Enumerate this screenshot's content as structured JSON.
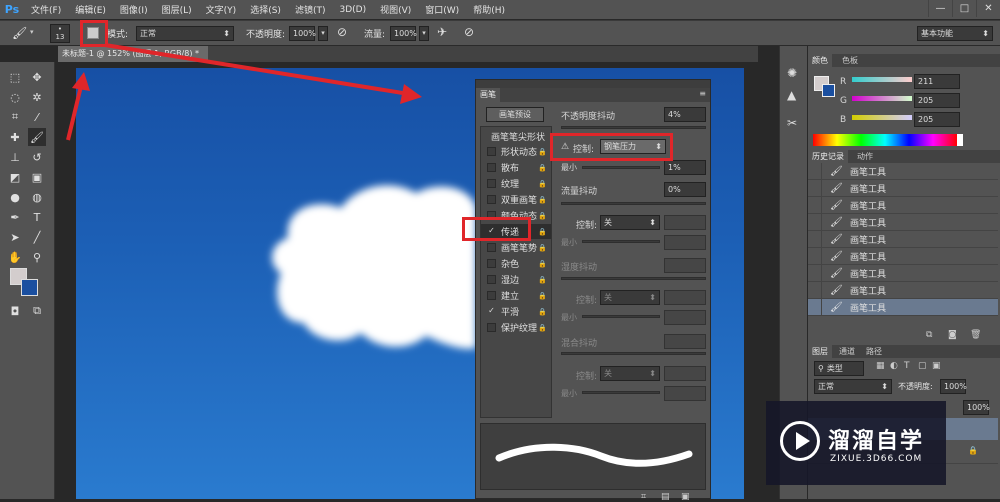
{
  "app": {
    "logo": "Ps"
  },
  "menu": [
    "文件(F)",
    "编辑(E)",
    "图像(I)",
    "图层(L)",
    "文字(Y)",
    "选择(S)",
    "滤镜(T)",
    "3D(D)",
    "视图(V)",
    "窗口(W)",
    "帮助(H)"
  ],
  "options": {
    "brush_size": "13",
    "mode_label": "模式:",
    "mode_value": "正常",
    "opacity_label": "不透明度:",
    "opacity_value": "100%",
    "flow_label": "流量:",
    "flow_value": "100%",
    "workspace": "基本功能"
  },
  "document_tab": "未标题-1 @ 152% (图层 1, RGB/8) *",
  "brush_panel": {
    "title": "画笔",
    "preset_button": "画笔预设",
    "tip_shape": "画笔笔尖形状",
    "items": [
      {
        "label": "形状动态",
        "checked": false
      },
      {
        "label": "散布",
        "checked": false
      },
      {
        "label": "纹理",
        "checked": false
      },
      {
        "label": "双重画笔",
        "checked": false
      },
      {
        "label": "颜色动态",
        "checked": false
      },
      {
        "label": "传递",
        "checked": true
      },
      {
        "label": "画笔笔势",
        "checked": false
      },
      {
        "label": "杂色",
        "checked": false
      },
      {
        "label": "湿边",
        "checked": false
      },
      {
        "label": "建立",
        "checked": false
      },
      {
        "label": "平滑",
        "checked": true
      },
      {
        "label": "保护纹理",
        "checked": false
      }
    ],
    "opacity_jitter_label": "不透明度抖动",
    "opacity_jitter_value": "4%",
    "control_label": "控制:",
    "control_value": "钢笔压力",
    "min_label": "最小",
    "min_value": "1%",
    "flow_jitter_label": "流量抖动",
    "flow_jitter_value": "0%",
    "control2_label": "控制:",
    "control2_value": "关",
    "min2_label": "最小",
    "wet_label": "湿度抖动",
    "control3_label": "控制:",
    "control3_value": "关",
    "min3_label": "最小",
    "mix_label": "混合抖动",
    "control4_label": "控制:",
    "control4_value": "关",
    "min4_label": "最小"
  },
  "color_panel": {
    "tabs": [
      "颜色",
      "色板"
    ],
    "r_label": "R",
    "r_value": "211",
    "g_label": "G",
    "g_value": "205",
    "b_label": "B",
    "b_value": "205"
  },
  "history_panel": {
    "tabs": [
      "历史记录",
      "动作"
    ],
    "items": [
      "画笔工具",
      "画笔工具",
      "画笔工具",
      "画笔工具",
      "画笔工具",
      "画笔工具",
      "画笔工具",
      "画笔工具",
      "画笔工具"
    ]
  },
  "layers_panel": {
    "tabs": [
      "图层",
      "通道",
      "路径"
    ],
    "kind_label": "类型",
    "blend_mode": "正常",
    "opacity_label": "不透明度:",
    "opacity_value": "100%",
    "fill_value": "100%"
  },
  "watermark": {
    "brand": "溜溜自学",
    "url": "ZIXUE.3D66.COM"
  },
  "colors": {
    "accent_red": "#e0262a",
    "sky_blue": "#1c5fb5",
    "panel_bg": "#535353"
  }
}
